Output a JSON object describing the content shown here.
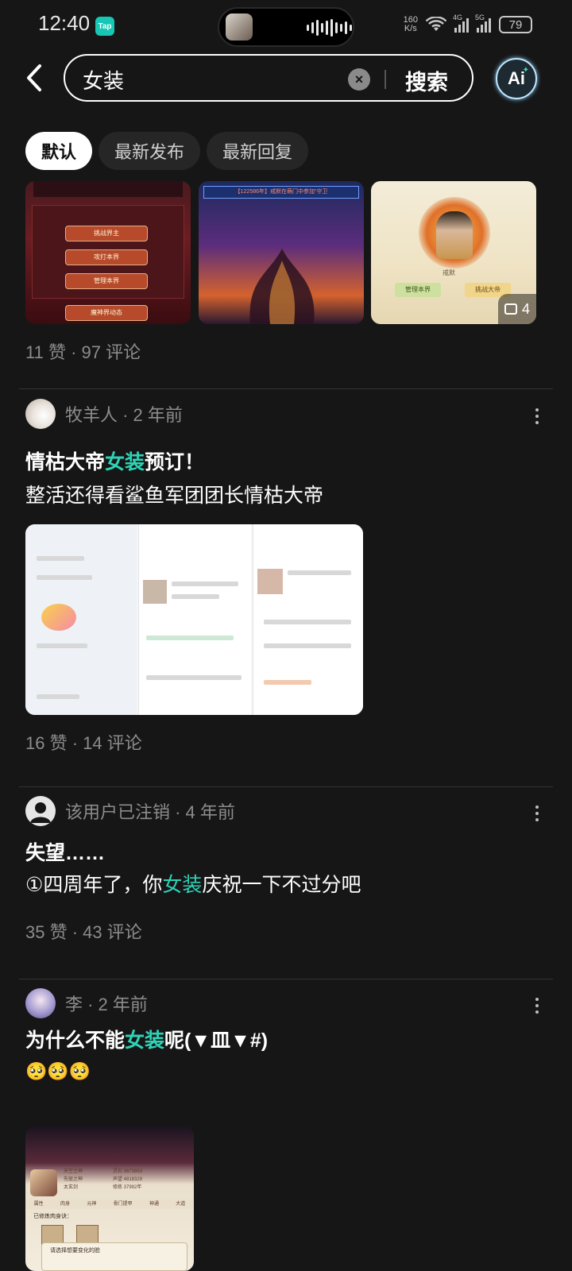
{
  "status_bar": {
    "time": "12:40",
    "app_badge": "Tap",
    "net_speed": "160\nK/s",
    "sim1_label": "4G",
    "sim2_label": "5G",
    "battery": "79"
  },
  "search": {
    "query": "女装",
    "button_label": "搜索",
    "ai_label": "Ai"
  },
  "tabs": [
    {
      "label": "默认",
      "active": true
    },
    {
      "label": "最新发布",
      "active": false
    },
    {
      "label": "最新回复",
      "active": false
    }
  ],
  "posts": [
    {
      "stats": "11 赞 · 97 评论",
      "image_count": "4",
      "thumb1_buttons": [
        "挑战界主",
        "攻打本界",
        "管理本界",
        "魔神界动态"
      ],
      "thumb2_banner": "【122586年】戒默在萌门中参加“守卫",
      "thumb3_buttons": [
        "管理本界",
        "挑战大帝"
      ],
      "thumb3_name": "戒默"
    },
    {
      "author": "牧羊人 · 2 年前",
      "title_pre": "情枯大帝",
      "title_hl": "女装",
      "title_post": "预订！",
      "body": "整活还得看鲨鱼军团团长情枯大帝",
      "stats": "16 赞 · 14 评论"
    },
    {
      "author": "该用户已注销 · 4 年前",
      "title": "失望……",
      "body_pre": "①四周年了，你",
      "body_hl": "女装",
      "body_post": "庆祝一下不过分吧",
      "stats": "35 赞 · 43 评论"
    },
    {
      "author": "李 · 2 年前",
      "title_pre": "为什么不能",
      "title_hl": "女装",
      "title_post": "呢(▼皿▼#)",
      "body": "🥺🥺🥺",
      "game_tabs": [
        "属性",
        "肉身",
        "元神",
        "骨门提甲",
        "神通",
        "大道"
      ],
      "game_stats": [
        "天空之神",
        "先驱之神",
        "太玄剑",
        "灵石 3673863",
        "声望 4818329",
        "修炼 37992年"
      ],
      "game_label": "已修炼肉身诀：",
      "game_popup": "请选择想要变化的脸"
    }
  ],
  "colors": {
    "background": "#161616",
    "highlight": "#2ed3b7",
    "meta_text": "#8c8c8c"
  }
}
